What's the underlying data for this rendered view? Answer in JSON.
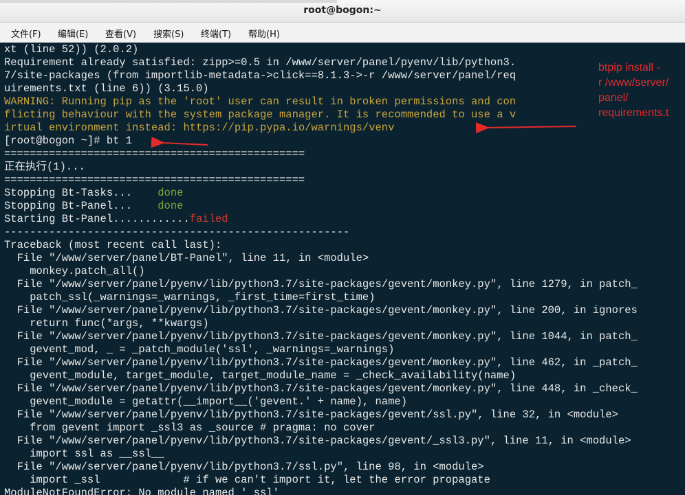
{
  "window": {
    "title": "root@bogon:~"
  },
  "menu": [
    "文件(F)",
    "编辑(E)",
    "查看(V)",
    "搜索(S)",
    "终端(T)",
    "帮助(H)"
  ],
  "terminal": {
    "lines": [
      {
        "text": "xt (line 52)) (2.0.2)",
        "cls": ""
      },
      {
        "text": "Requirement already satisfied: zipp>=0.5 in /www/server/panel/pyenv/lib/python3.",
        "cls": ""
      },
      {
        "text": "7/site-packages (from importlib-metadata->click==8.1.3->-r /www/server/panel/req",
        "cls": ""
      },
      {
        "text": "uirements.txt (line 6)) (3.15.0)",
        "cls": ""
      },
      {
        "text": "WARNING: Running pip as the 'root' user can result in broken permissions and con",
        "cls": "warn"
      },
      {
        "text": "flicting behaviour with the system package manager. It is recommended to use a v",
        "cls": "warn"
      },
      {
        "text": "irtual environment instead: https://pip.pypa.io/warnings/venv",
        "cls": "warn"
      },
      {
        "text": "[root@bogon ~]# bt 1",
        "cls": ""
      },
      {
        "text": "===============================================",
        "cls": ""
      },
      {
        "text": "正在执行(1)...",
        "cls": ""
      },
      {
        "text": "===============================================",
        "cls": ""
      },
      {
        "parts": [
          {
            "text": "Stopping Bt-Tasks...    ",
            "cls": ""
          },
          {
            "text": "done",
            "cls": "ok"
          }
        ]
      },
      {
        "parts": [
          {
            "text": "Stopping Bt-Panel...    ",
            "cls": ""
          },
          {
            "text": "done",
            "cls": "ok"
          }
        ]
      },
      {
        "parts": [
          {
            "text": "Starting Bt-Panel............",
            "cls": ""
          },
          {
            "text": "failed",
            "cls": "fail"
          }
        ]
      },
      {
        "text": "------------------------------------------------------",
        "cls": ""
      },
      {
        "text": "Traceback (most recent call last):",
        "cls": ""
      },
      {
        "text": "  File \"/www/server/panel/BT-Panel\", line 11, in <module>",
        "cls": ""
      },
      {
        "text": "    monkey.patch_all()",
        "cls": ""
      },
      {
        "text": "  File \"/www/server/panel/pyenv/lib/python3.7/site-packages/gevent/monkey.py\", line 1279, in patch_",
        "cls": ""
      },
      {
        "text": "    patch_ssl(_warnings=_warnings, _first_time=first_time)",
        "cls": ""
      },
      {
        "text": "  File \"/www/server/panel/pyenv/lib/python3.7/site-packages/gevent/monkey.py\", line 200, in ignores",
        "cls": ""
      },
      {
        "text": "    return func(*args, **kwargs)",
        "cls": ""
      },
      {
        "text": "  File \"/www/server/panel/pyenv/lib/python3.7/site-packages/gevent/monkey.py\", line 1044, in patch_",
        "cls": ""
      },
      {
        "text": "    gevent_mod, _ = _patch_module('ssl', _warnings=_warnings)",
        "cls": ""
      },
      {
        "text": "  File \"/www/server/panel/pyenv/lib/python3.7/site-packages/gevent/monkey.py\", line 462, in _patch_",
        "cls": ""
      },
      {
        "text": "    gevent_module, target_module, target_module_name = _check_availability(name)",
        "cls": ""
      },
      {
        "text": "  File \"/www/server/panel/pyenv/lib/python3.7/site-packages/gevent/monkey.py\", line 448, in _check_",
        "cls": ""
      },
      {
        "text": "    gevent_module = getattr(__import__('gevent.' + name), name)",
        "cls": ""
      },
      {
        "text": "  File \"/www/server/panel/pyenv/lib/python3.7/site-packages/gevent/ssl.py\", line 32, in <module>",
        "cls": ""
      },
      {
        "text": "    from gevent import _ssl3 as _source # pragma: no cover",
        "cls": ""
      },
      {
        "text": "  File \"/www/server/panel/pyenv/lib/python3.7/site-packages/gevent/_ssl3.py\", line 11, in <module>",
        "cls": ""
      },
      {
        "text": "    import ssl as __ssl__",
        "cls": ""
      },
      {
        "text": "  File \"/www/server/panel/pyenv/lib/python3.7/ssl.py\", line 98, in <module>",
        "cls": ""
      },
      {
        "text": "    import _ssl             # if we can't import it, let the error propagate",
        "cls": ""
      },
      {
        "text": "ModuleNotFoundError: No module named '_ssl'",
        "cls": ""
      }
    ]
  },
  "annotation": {
    "lines": [
      "btpip install  -",
      "r /www/server/",
      "panel/",
      "requirements.t"
    ]
  },
  "colors": {
    "terminal_bg": "#0b2330",
    "annotation": "#e52a2a",
    "warning": "#c9a43c"
  }
}
